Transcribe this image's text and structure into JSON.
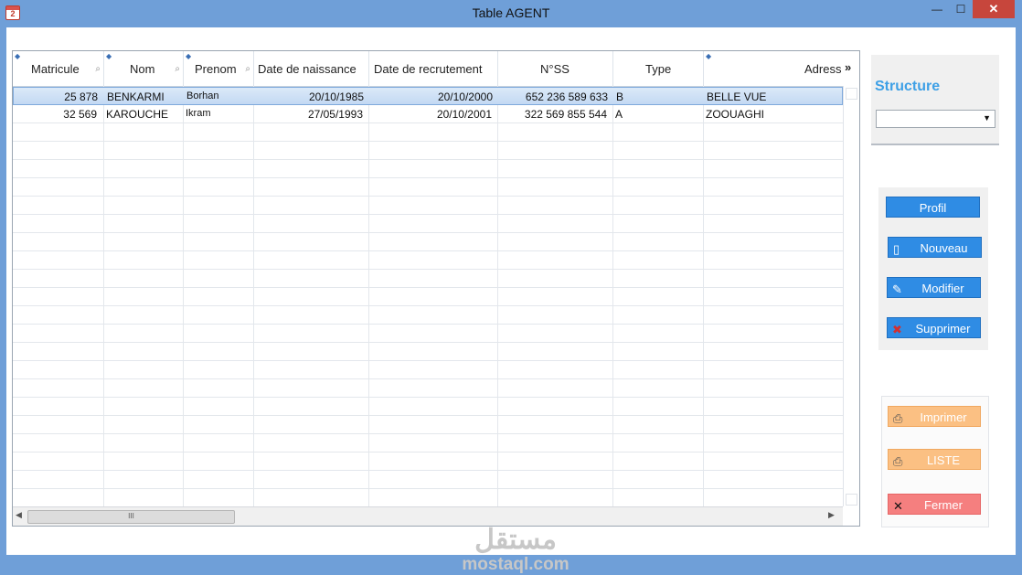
{
  "window": {
    "title": "Table AGENT",
    "app_icon_glyph": "2",
    "min": "—",
    "max": "☐",
    "close": "✕"
  },
  "table": {
    "columns": [
      {
        "label": "Matricule",
        "sort": true,
        "search": true
      },
      {
        "label": "Nom",
        "sort": true,
        "search": true
      },
      {
        "label": "Prenom",
        "sort": true,
        "search": true
      },
      {
        "label": "Date de naissance",
        "sort": false,
        "search": false
      },
      {
        "label": "Date de recrutement",
        "sort": false,
        "search": false
      },
      {
        "label": "N°SS",
        "sort": false,
        "search": false
      },
      {
        "label": "Type",
        "sort": false,
        "search": false
      },
      {
        "label": "Adress",
        "sort": true,
        "search": false
      }
    ],
    "more_glyph": "»",
    "rows": [
      {
        "matricule": "25 878",
        "nom": "BENKARMI",
        "prenom": "Borhan",
        "naissance": "20/10/1985",
        "recrutement": "20/10/2000",
        "nss": "652 236 589 633",
        "type": "B",
        "adresse": "BELLE VUE",
        "selected": true
      },
      {
        "matricule": "32 569",
        "nom": "KAROUCHE",
        "prenom": "Ikram",
        "naissance": "27/05/1993",
        "recrutement": "20/10/2001",
        "nss": "322 569 855 544",
        "type": "A",
        "adresse": "ZOOUAGHI",
        "selected": false
      }
    ],
    "hscroll_left": "◀",
    "hscroll_right": "▶",
    "hscroll_thumb": "III"
  },
  "structure": {
    "title": "Structure",
    "selected": "",
    "arrow": "▼"
  },
  "actions": [
    {
      "label": "Profil",
      "icon": "none",
      "glyph": ""
    },
    {
      "label": "Nouveau",
      "icon": "new-document-icon",
      "glyph": "▯"
    },
    {
      "label": "Modifier",
      "icon": "edit-icon",
      "glyph": "✎"
    },
    {
      "label": "Supprimer",
      "icon": "delete-x-icon",
      "glyph": "✖"
    }
  ],
  "secondary_actions": [
    {
      "label": "Imprimer",
      "icon": "printer-icon",
      "glyph": "⎙"
    },
    {
      "label": "LISTE",
      "icon": "printer-icon",
      "glyph": "⎙"
    },
    {
      "label": "Fermer",
      "icon": "close-x-icon",
      "glyph": "✕"
    }
  ],
  "watermark": {
    "arabic": "مستقل",
    "latin": "mostaql.com"
  },
  "colors": {
    "accent_blue": "#2f8ce4",
    "structure_title": "#3ea0e6",
    "orange": "#fbc083",
    "red": "#f57f7f",
    "close_button": "#c7463c",
    "selection": "#c3d9f3"
  }
}
